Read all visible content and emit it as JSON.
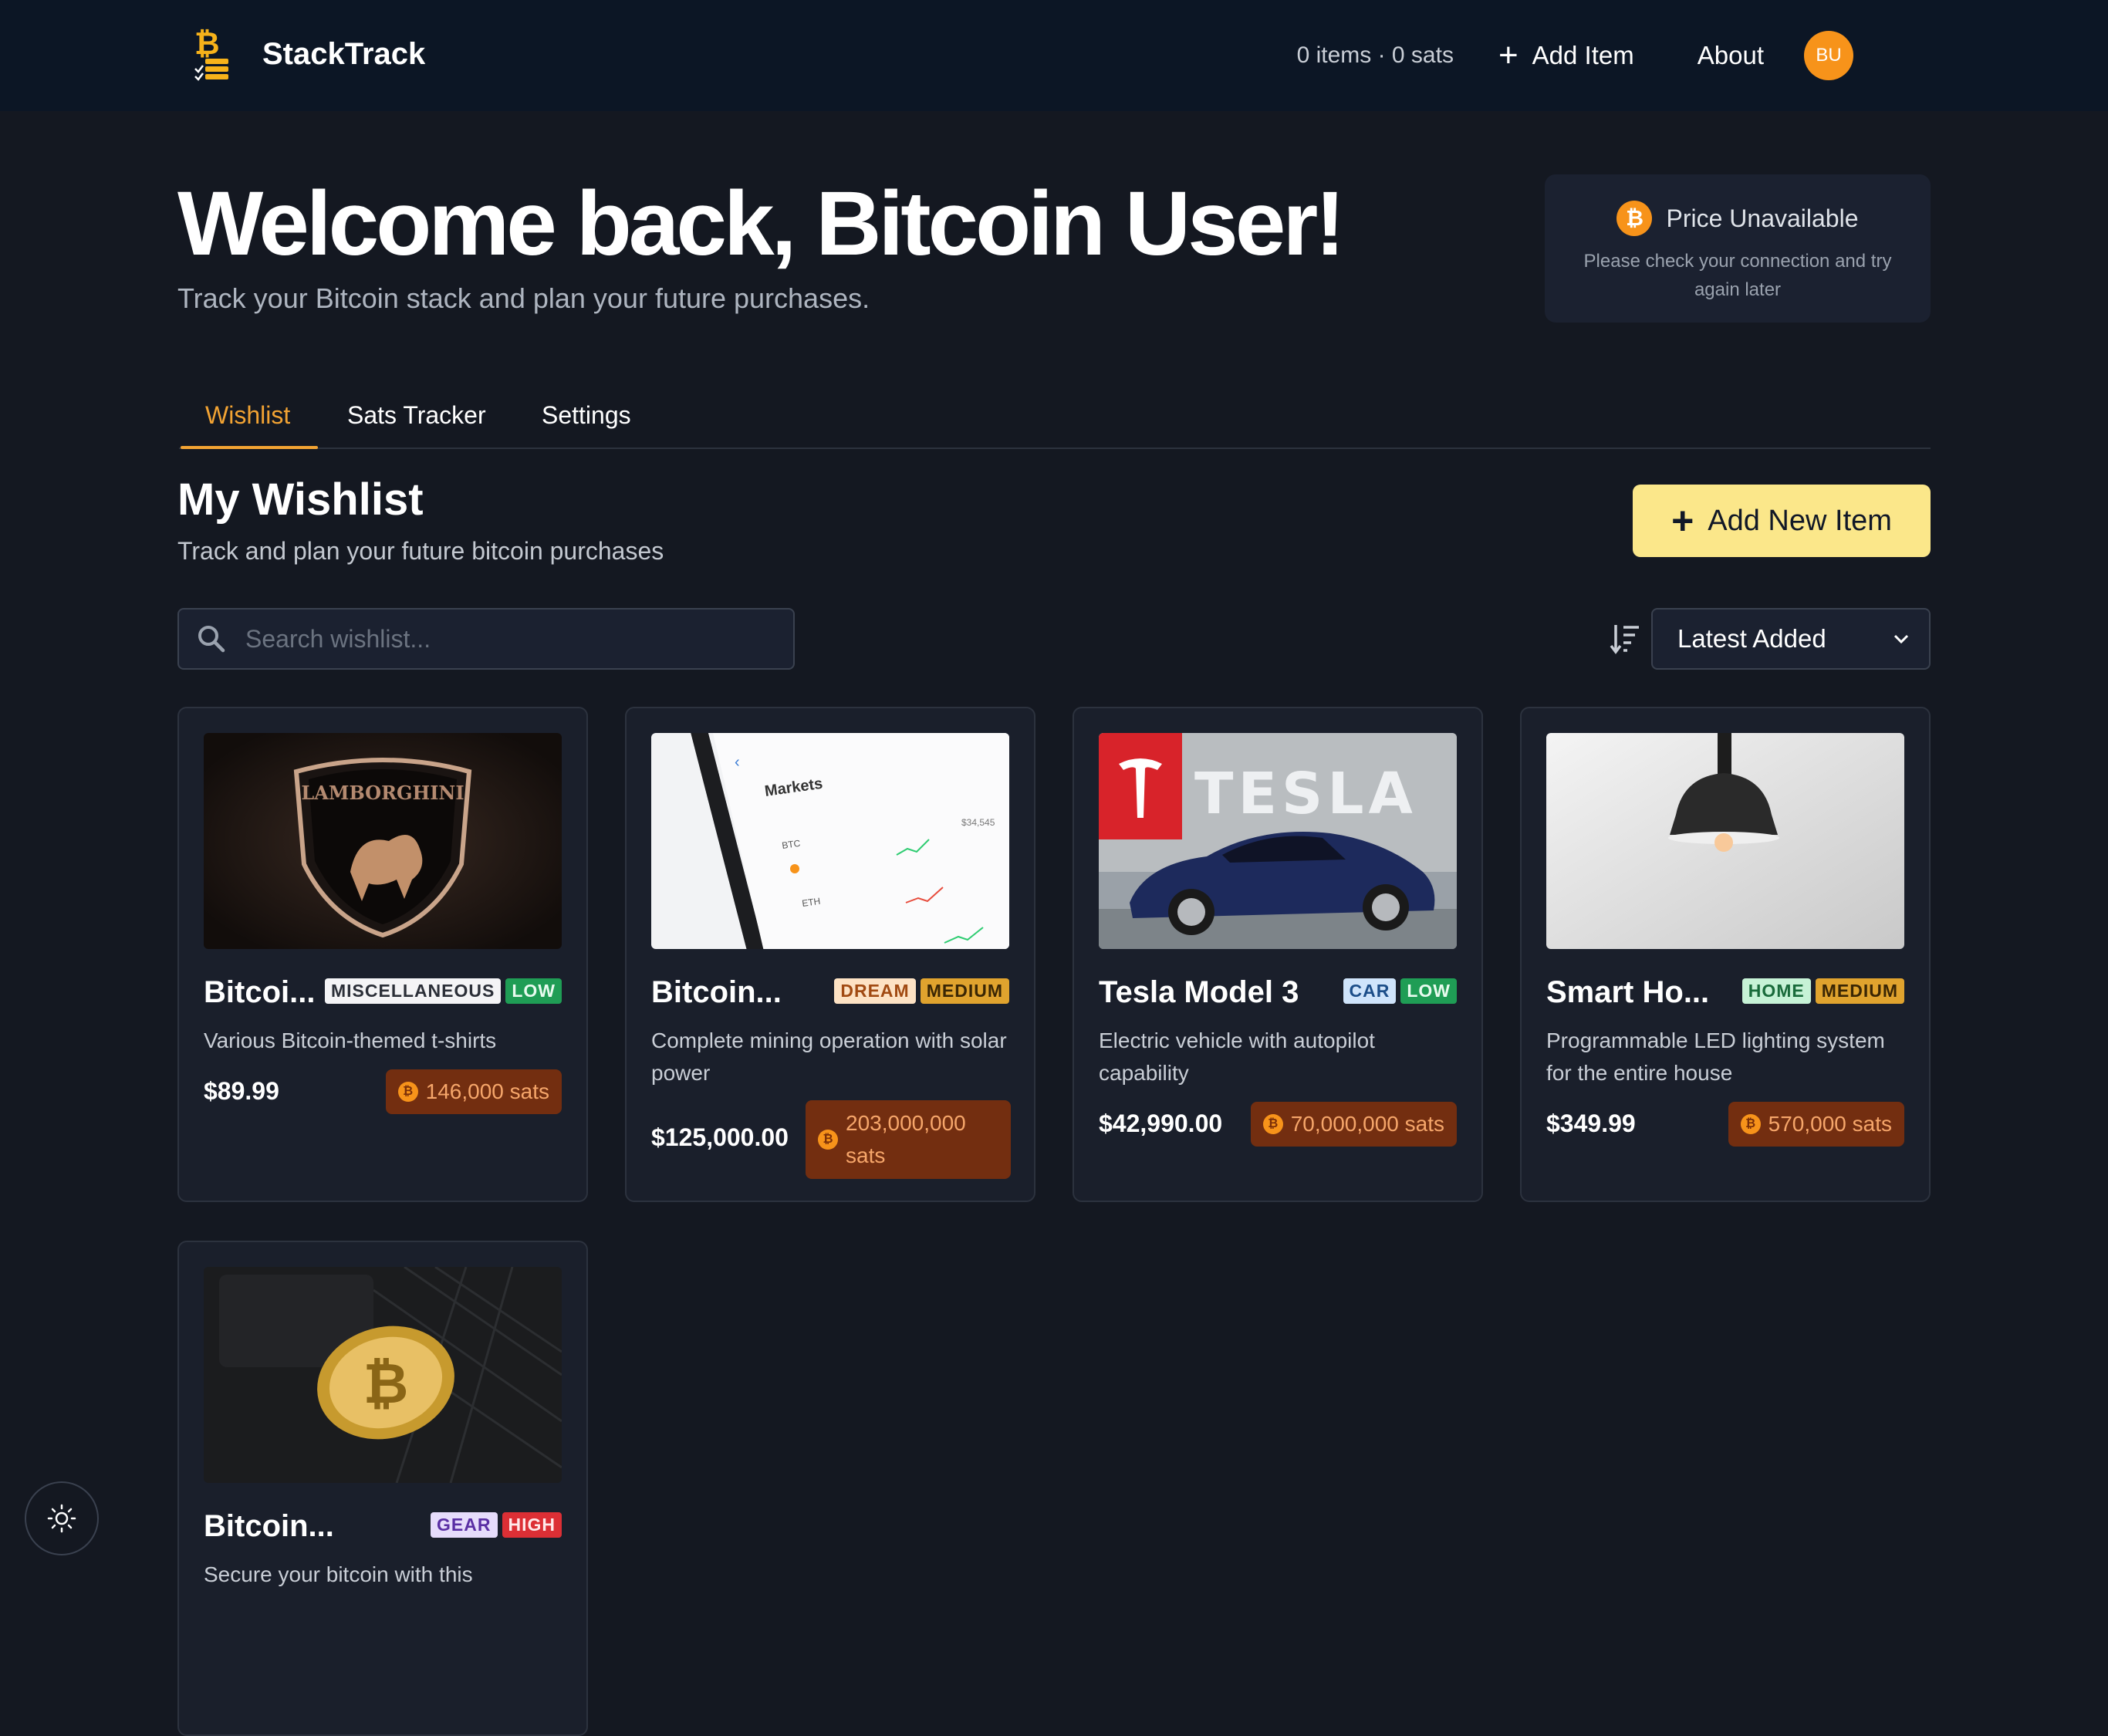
{
  "app": {
    "name": "StackTrack"
  },
  "nav": {
    "count": "0 items · 0 sats",
    "add_item": "Add Item",
    "about": "About",
    "avatar_initials": "BU",
    "avatar_color": "#f7931a"
  },
  "hero": {
    "title": "Welcome back, Bitcoin User!",
    "subtitle": "Track your Bitcoin stack and plan your future purchases."
  },
  "price": {
    "title": "Price Unavailable",
    "message": "Please check your connection and try again later"
  },
  "tabs": [
    {
      "label": "Wishlist",
      "active": true
    },
    {
      "label": "Sats Tracker",
      "active": false
    },
    {
      "label": "Settings",
      "active": false
    }
  ],
  "wishlist": {
    "title": "My Wishlist",
    "subtitle": "Track and plan your future bitcoin purchases",
    "add_button": "Add New Item",
    "search_placeholder": "Search wishlist...",
    "sort_value": "Latest Added"
  },
  "items": [
    {
      "name": "Bitcoi...",
      "category": "MISCELLANEOUS",
      "priority": "LOW",
      "description": "Various Bitcoin-themed t-shirts",
      "price": "$89.99",
      "sats": "146,000 sats",
      "image": "lamborghini-emblem"
    },
    {
      "name": "Bitcoin...",
      "category": "DREAM",
      "priority": "MEDIUM",
      "description": "Complete mining operation with solar power",
      "price": "$125,000.00",
      "sats": "203,000,000 sats",
      "image": "markets-phone"
    },
    {
      "name": "Tesla Model 3",
      "category": "CAR",
      "priority": "LOW",
      "description": "Electric vehicle with autopilot capability",
      "price": "$42,990.00",
      "sats": "70,000,000 sats",
      "image": "tesla-car"
    },
    {
      "name": "Smart Ho...",
      "category": "HOME",
      "priority": "MEDIUM",
      "description": "Programmable LED lighting system for the entire house",
      "price": "$349.99",
      "sats": "570,000 sats",
      "image": "pendant-lamp"
    },
    {
      "name": "Bitcoin...",
      "category": "GEAR",
      "priority": "HIGH",
      "description": "Secure your bitcoin with this",
      "image": "bitcoin-coin-keyboard"
    }
  ],
  "colors": {
    "accent": "#f2a333",
    "background": "#141821",
    "header": "#0c1625",
    "button_yellow": "#fbe78a",
    "btc_orange": "#f7931a"
  }
}
